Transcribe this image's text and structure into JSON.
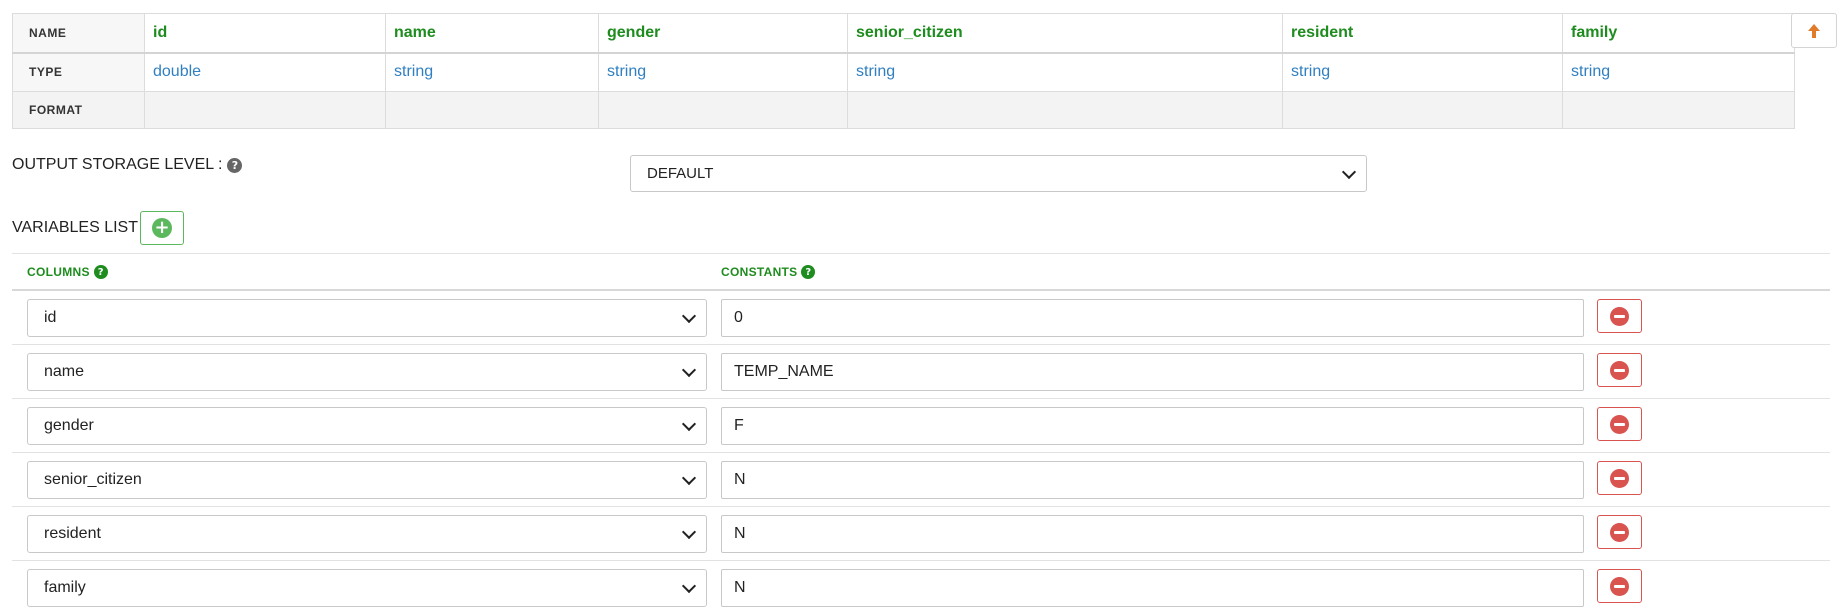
{
  "schema": {
    "row_labels": {
      "name": "NAME",
      "type": "TYPE",
      "format": "FORMAT"
    },
    "columns": [
      {
        "name": "id",
        "type": "double",
        "format": ""
      },
      {
        "name": "name",
        "type": "string",
        "format": ""
      },
      {
        "name": "gender",
        "type": "string",
        "format": ""
      },
      {
        "name": "senior_citizen",
        "type": "string",
        "format": ""
      },
      {
        "name": "resident",
        "type": "string",
        "format": ""
      },
      {
        "name": "family",
        "type": "string",
        "format": ""
      }
    ]
  },
  "scroll_top": {
    "icon": "arrow-up-icon",
    "color": "#e07b2a"
  },
  "storage": {
    "label": "OUTPUT STORAGE LEVEL :",
    "value": "DEFAULT"
  },
  "variables": {
    "label": "VARIABLES LIST :",
    "columns_header": "COLUMNS",
    "constants_header": "CONSTANTS",
    "rows": [
      {
        "column": "id",
        "constant": "0"
      },
      {
        "column": "name",
        "constant": "TEMP_NAME"
      },
      {
        "column": "gender",
        "constant": "F"
      },
      {
        "column": "senior_citizen",
        "constant": "N"
      },
      {
        "column": "resident",
        "constant": "N"
      },
      {
        "column": "family",
        "constant": "N"
      }
    ]
  },
  "colors": {
    "accent_green": "#1e8c1e",
    "type_blue": "#2f7fc1",
    "danger": "#d9534f",
    "add_green": "#5cb85c"
  }
}
